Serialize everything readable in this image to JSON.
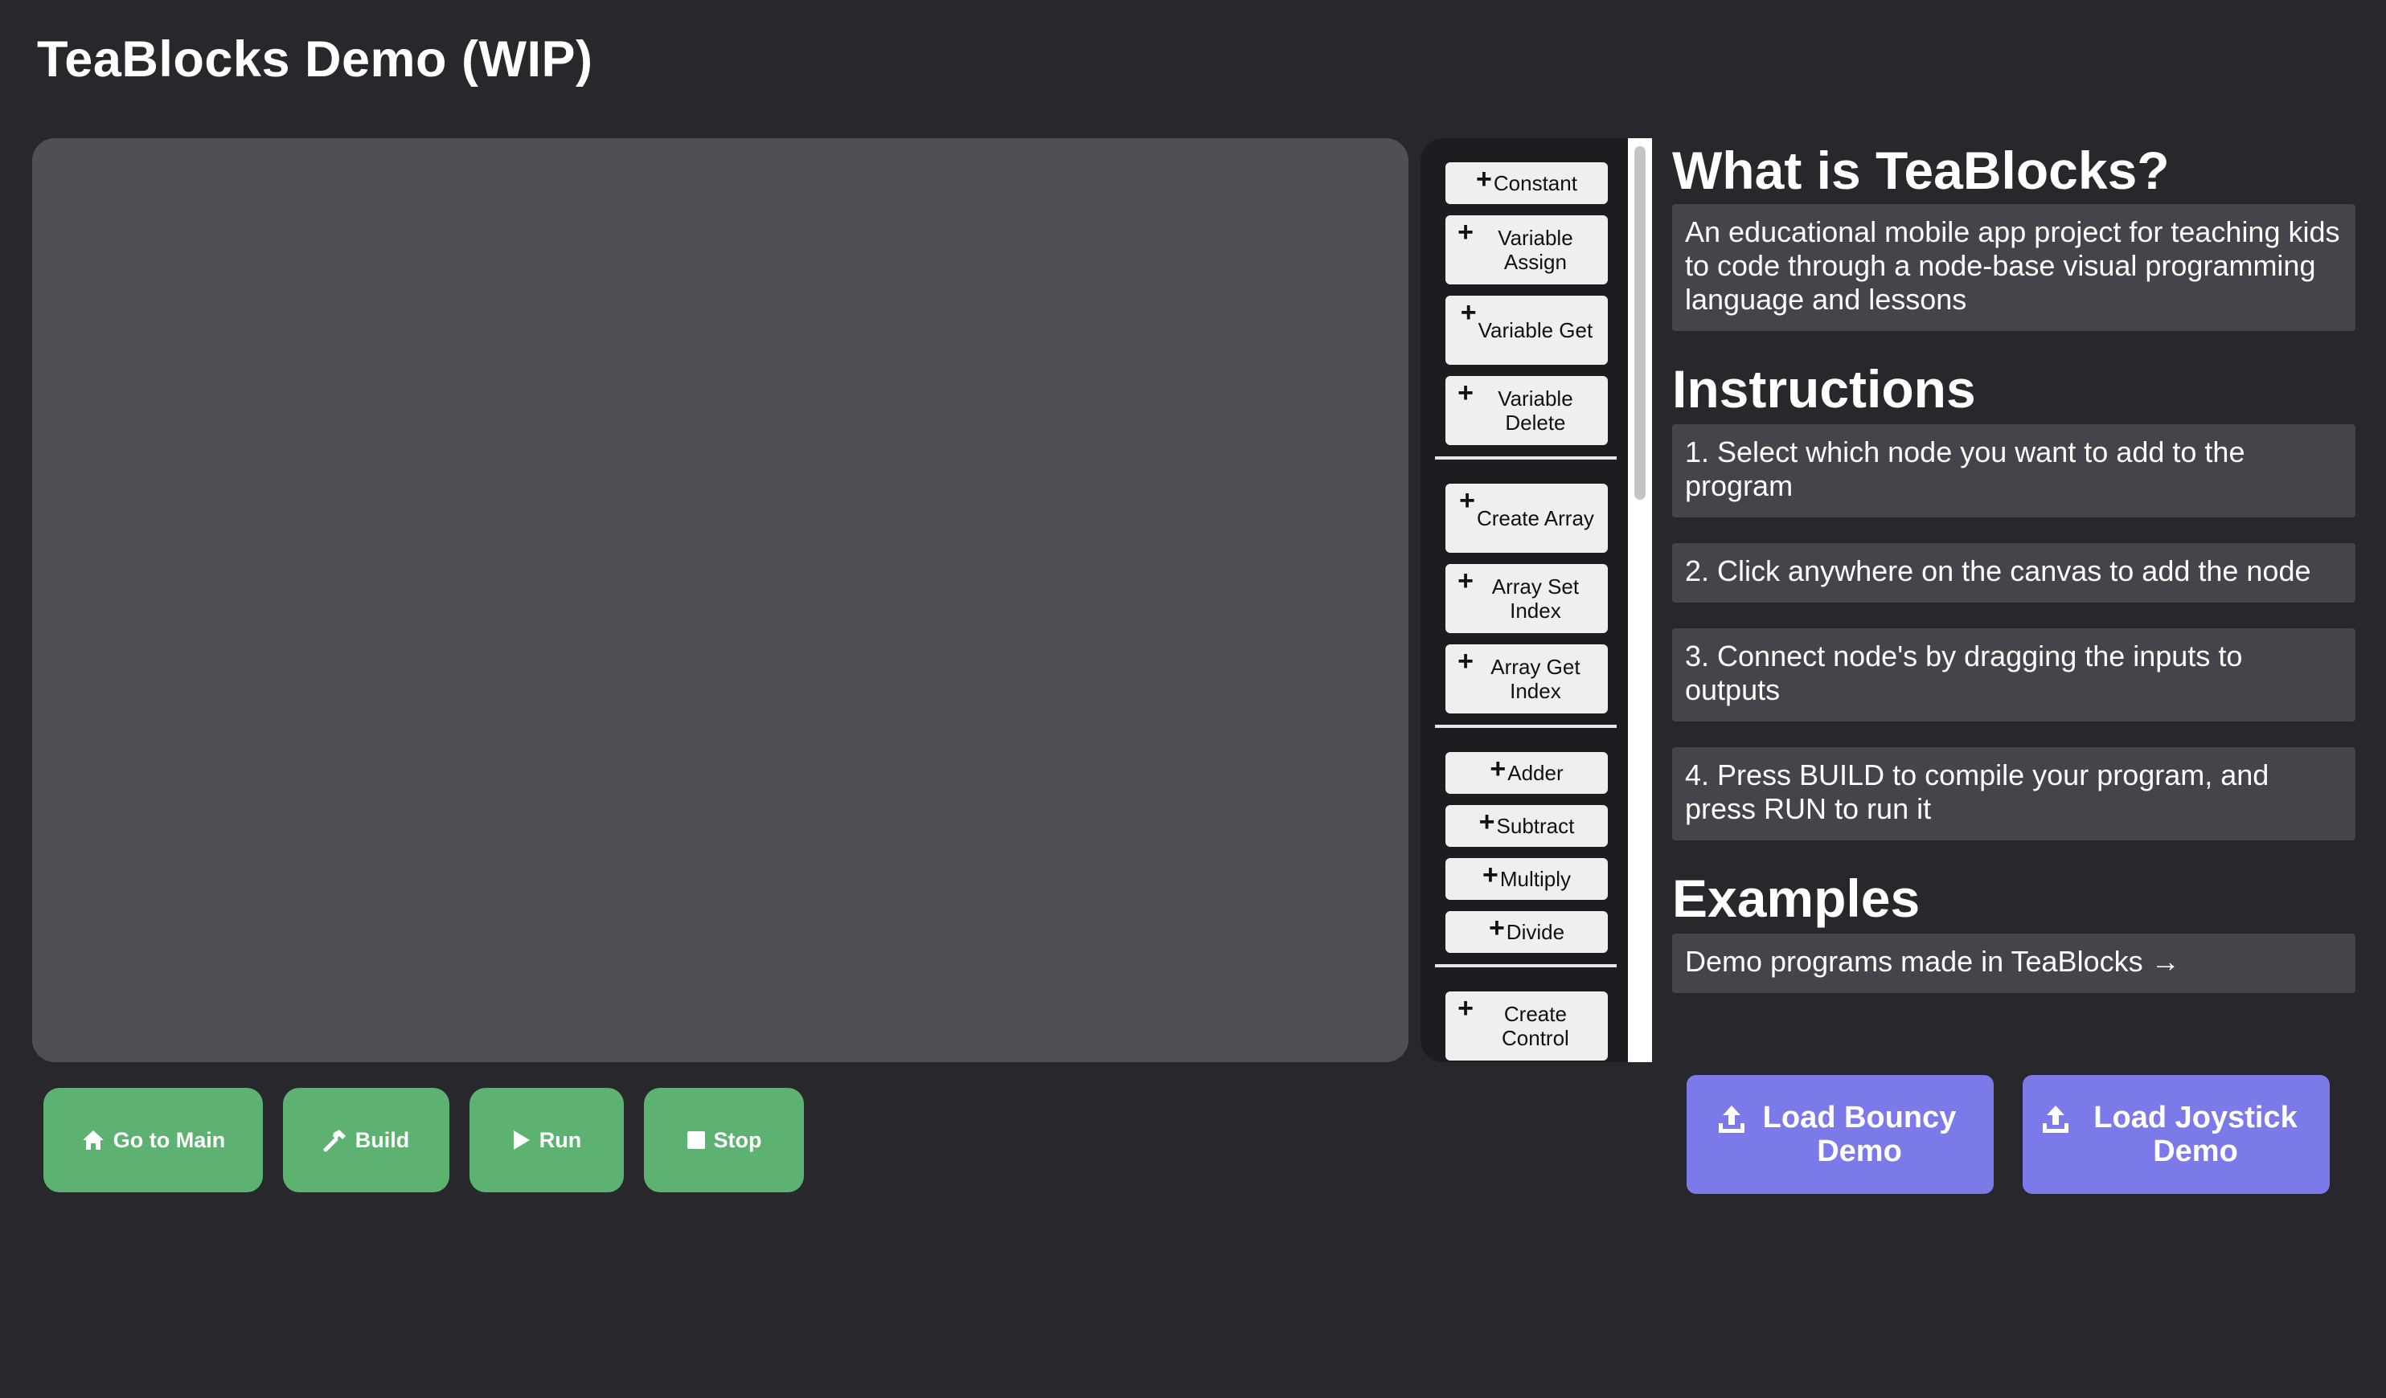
{
  "app": {
    "title": "TeaBlocks Demo (WIP)"
  },
  "palette": {
    "groups": [
      [
        {
          "icon": "plus-icon",
          "label": "Constant"
        },
        {
          "icon": "plus-icon",
          "label": "Variable Assign"
        },
        {
          "icon": "plus-icon",
          "label": "Variable Get"
        },
        {
          "icon": "plus-icon",
          "label": "Variable Delete"
        }
      ],
      [
        {
          "icon": "plus-icon",
          "label": "Create Array"
        },
        {
          "icon": "plus-icon",
          "label": "Array Set Index"
        },
        {
          "icon": "plus-icon",
          "label": "Array Get Index"
        }
      ],
      [
        {
          "icon": "plus-icon",
          "label": "Adder"
        },
        {
          "icon": "plus-icon",
          "label": "Subtract"
        },
        {
          "icon": "plus-icon",
          "label": "Multiply"
        },
        {
          "icon": "plus-icon",
          "label": "Divide"
        }
      ],
      [
        {
          "icon": "plus-icon",
          "label": "Create Control"
        }
      ]
    ]
  },
  "info": {
    "what_heading": "What is TeaBlocks?",
    "what_text": "An educational mobile app project for teaching kids to code through a node-base visual programming language and lessons",
    "instructions_heading": "Instructions",
    "steps": [
      "1. Select which node you want to add to the program",
      "2. Click anywhere on the canvas to add the node",
      "3. Connect node's by dragging the inputs to outputs",
      "4. Press BUILD to compile your program, and press RUN to run it"
    ],
    "examples_heading": "Examples",
    "examples_link": "Demo programs made in TeaBlocks →"
  },
  "controls": {
    "go_to_main": "Go to Main",
    "build": "Build",
    "run": "Run",
    "stop": "Stop"
  },
  "demos": {
    "bouncy": "Load Bouncy Demo",
    "joystick": "Load Joystick Demo"
  },
  "colors": {
    "background": "#27272c",
    "canvas": "#4f4f55",
    "control_button": "#5db272",
    "demo_button": "#7c7ae8",
    "card": "#44444a"
  }
}
